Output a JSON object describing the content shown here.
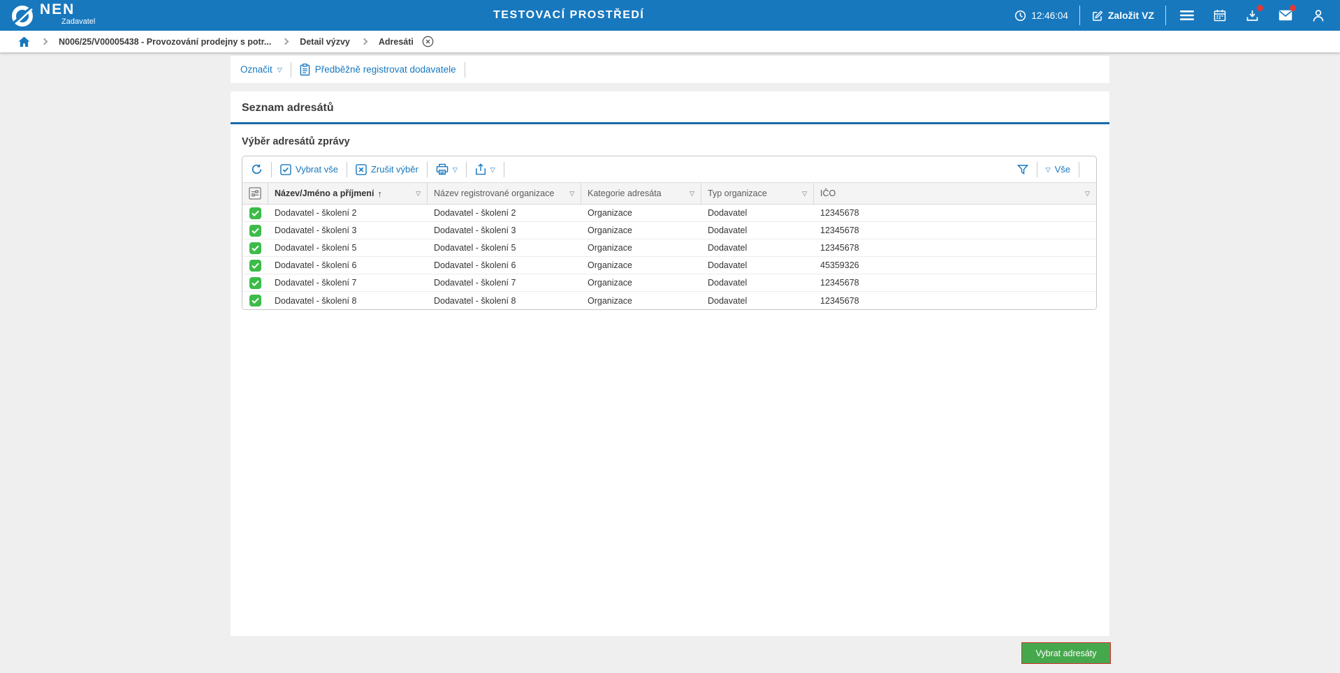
{
  "colors": {
    "topbar_blue": "#1878be",
    "accent_blue": "#1878be",
    "section_rule_blue": "#1769a9",
    "row_checkbox_green": "#3dbb4a",
    "submit_button_green": "#46a84c",
    "submit_button_border_red": "#d22c2c",
    "notification_badge_red": "#e53935"
  },
  "topbar": {
    "logo_text": "NEN",
    "logo_subtitle": "Zadavatel",
    "environment_title": "TESTOVACÍ PROSTŘEDÍ",
    "time": "12:46:04",
    "create_vz_label": "Založit VZ"
  },
  "breadcrumb": {
    "items": [
      "N006/25/V00005438 - Provozování prodejny s potr...",
      "Detail výzvy",
      "Adresáti"
    ]
  },
  "actions": {
    "mark_label": "Označit",
    "preregister_label": "Předběžně registrovat dodavatele"
  },
  "main": {
    "section_title": "Seznam adresátů",
    "subsection_title": "Výběr adresátů zprávy",
    "grid": {
      "toolbar": {
        "select_all": "Vybrat vše",
        "clear_selection": "Zrušit výběr",
        "view_all": "Vše"
      },
      "columns": [
        "Název/Jméno a příjmení",
        "Název registrované organizace",
        "Kategorie adresáta",
        "Typ organizace",
        "IČO"
      ],
      "sort_indicator": "↑",
      "rows": [
        {
          "checked": true,
          "name": "Dodavatel - školení 2",
          "registered_org": "Dodavatel - školení 2",
          "category": "Organizace",
          "org_type": "Dodavatel",
          "ico": "12345678"
        },
        {
          "checked": true,
          "name": "Dodavatel - školení 3",
          "registered_org": "Dodavatel - školení 3",
          "category": "Organizace",
          "org_type": "Dodavatel",
          "ico": "12345678"
        },
        {
          "checked": true,
          "name": "Dodavatel - školení 5",
          "registered_org": "Dodavatel - školení 5",
          "category": "Organizace",
          "org_type": "Dodavatel",
          "ico": "12345678"
        },
        {
          "checked": true,
          "name": "Dodavatel - školení 6",
          "registered_org": "Dodavatel - školení 6",
          "category": "Organizace",
          "org_type": "Dodavatel",
          "ico": "45359326"
        },
        {
          "checked": true,
          "name": "Dodavatel - školení 7",
          "registered_org": "Dodavatel - školení 7",
          "category": "Organizace",
          "org_type": "Dodavatel",
          "ico": "12345678"
        },
        {
          "checked": true,
          "name": "Dodavatel - školení 8",
          "registered_org": "Dodavatel - školení 8",
          "category": "Organizace",
          "org_type": "Dodavatel",
          "ico": "12345678"
        }
      ]
    },
    "submit_label": "Vybrat adresáty"
  }
}
